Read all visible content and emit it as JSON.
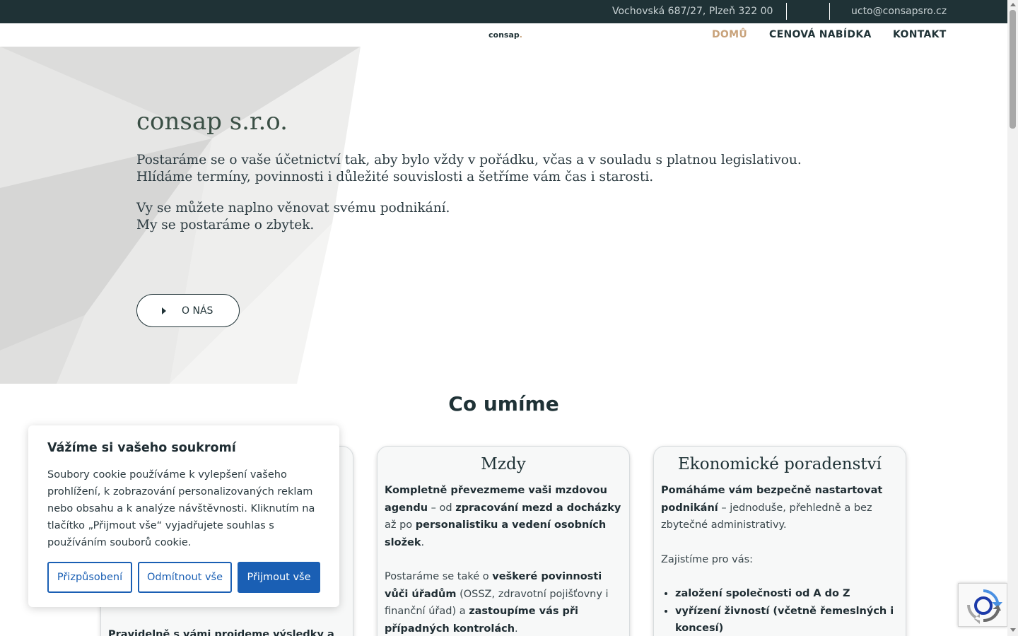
{
  "topbar": {
    "address": "Vochovská 687/27, Plzeň 322 00",
    "email": "ucto@consapsro.cz"
  },
  "navbar": {
    "logo": "consap",
    "logo_dot": ".",
    "items": [
      {
        "label": "DOMŮ",
        "active": true
      },
      {
        "label": "CENOVÁ NABÍDKA",
        "active": false
      },
      {
        "label": "KONTAKT",
        "active": false
      }
    ]
  },
  "hero": {
    "title": "consap s.r.o.",
    "para1": "Postaráme se o vaše účetnictví tak, aby bylo vždy v pořádku, včas a v souladu s platnou legislativou. Hlídáme termíny, povinnosti i důležité souvislosti a šetříme vám čas i starosti.",
    "para2_line1": "Vy se můžete naplno věnovat svému podnikání.",
    "para2_line2": "My se postaráme o zbytek.",
    "button_label": "O NÁS"
  },
  "services": {
    "title": "Co umíme",
    "card_mzdy": {
      "title": "Mzdy"
    },
    "card_poradenstvi": {
      "title": "Ekonomické poradenství"
    },
    "card_left_partial": "Pravidelně s vámi projdeme výsledky a"
  },
  "cookie": {
    "heading": "Vážíme si vašeho soukromí",
    "text": "Soubory cookie používáme k vylepšení vašeho prohlížení, k zobrazování personalizovaných reklam nebo obsahu a k analýze návštěvnosti. Kliknutím na tlačítko „Přijmout vše“ vyjadřujete souhlas s používáním souborů cookie.",
    "btn_customize": "Přizpůsobení",
    "btn_reject": "Odmítnout vše",
    "btn_accept": "Přijmout vše"
  },
  "colors": {
    "topbar_bg": "#1f3236",
    "accent": "#c8a27a",
    "cookie_blue": "#1a5fb4"
  },
  "icons": [
    "arrow-right-icon",
    "recaptcha-icon"
  ]
}
